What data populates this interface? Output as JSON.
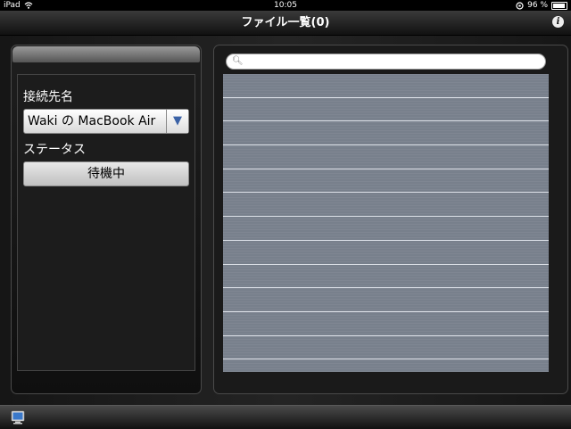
{
  "status_bar": {
    "device": "iPad",
    "time": "10:05",
    "battery": "96 %",
    "battery_level": 0.96
  },
  "nav": {
    "title": "ファイル一覧(0)",
    "info_icon": "info-icon"
  },
  "left_panel": {
    "connection_label": "接続先名",
    "connection_value": "Waki の MacBook Air",
    "status_label": "ステータス",
    "status_value": "待機中"
  },
  "search": {
    "placeholder": "",
    "icon": "search-icon"
  },
  "file_list": {
    "rows": [
      "",
      "",
      "",
      "",
      "",
      "",
      "",
      "",
      "",
      "",
      "",
      ""
    ]
  },
  "toolbar": {
    "icon": "computer-icon"
  }
}
